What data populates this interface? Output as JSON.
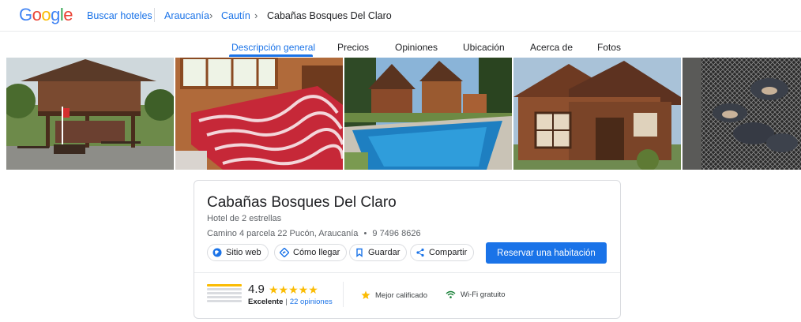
{
  "header": {
    "logo_letters": [
      {
        "char": "G",
        "color": "#4285f4"
      },
      {
        "char": "o",
        "color": "#ea4335"
      },
      {
        "char": "o",
        "color": "#fbbc04"
      },
      {
        "char": "g",
        "color": "#4285f4"
      },
      {
        "char": "l",
        "color": "#34a853"
      },
      {
        "char": "e",
        "color": "#ea4335"
      }
    ],
    "search_hotels": "Buscar hoteles",
    "breadcrumb": {
      "region": "Araucanía",
      "city": "Cautín",
      "current": "Cabañas Bosques Del Claro"
    }
  },
  "tabs": [
    {
      "label": "Descripción general",
      "active": true
    },
    {
      "label": "Precios",
      "active": false
    },
    {
      "label": "Opiniones",
      "active": false
    },
    {
      "label": "Ubicación",
      "active": false
    },
    {
      "label": "Acerca de",
      "active": false
    },
    {
      "label": "Fotos",
      "active": false
    }
  ],
  "hotel": {
    "name": "Cabañas Bosques Del Claro",
    "class": "Hotel de 2 estrellas",
    "address": "Camino 4 parcela 22 Pucón, Araucanía",
    "phone": "9 7496 8626",
    "address_separator": "•"
  },
  "actions": {
    "website": "Sitio web",
    "directions": "Cómo llegar",
    "save": "Guardar",
    "share": "Compartir",
    "reserve": "Reservar una habitación"
  },
  "rating": {
    "score": "4.9",
    "stars": "★★★★★",
    "label": "Excelente",
    "separator": "|",
    "reviews": "22 opiniones"
  },
  "amenities": {
    "top_rated": "Mejor calificado",
    "wifi": "Wi-Fi gratuito"
  },
  "colors": {
    "accent": "#1a73e8",
    "star": "#fbbc04"
  }
}
